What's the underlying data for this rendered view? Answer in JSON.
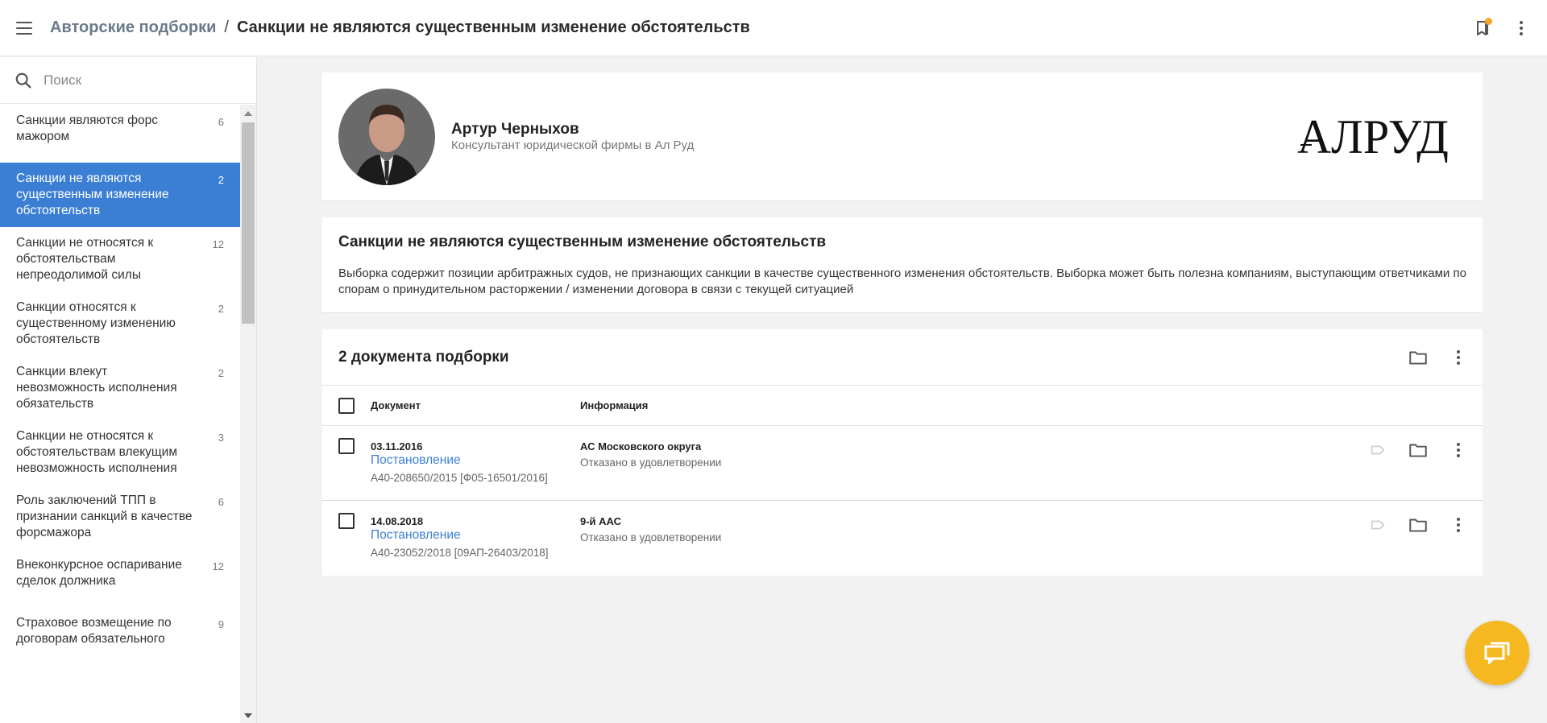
{
  "header": {
    "breadcrumb_parent": "Авторские подборки",
    "breadcrumb_separator": "/",
    "breadcrumb_current": "Санкции не являются существенным изменение обстоятельств"
  },
  "search": {
    "placeholder": "Поиск"
  },
  "sidebar": {
    "items": [
      {
        "label": "Санкции являются форс мажором",
        "count": "6"
      },
      {
        "label": "Санкции не являются существенным изменение обстоятельств",
        "count": "2"
      },
      {
        "label": "Санкции не относятся к обстоятельствам непреодолимой силы",
        "count": "12"
      },
      {
        "label": "Санкции относятся к существенному изменению обстоятельств",
        "count": "2"
      },
      {
        "label": "Санкции влекут невозможность исполнения обязательств",
        "count": "2"
      },
      {
        "label": "Санкции не относятся к обстоятельствам влекущим невозможность исполнения",
        "count": "3"
      },
      {
        "label": "Роль заключений ТПП в признании санкций в качестве форсмажора",
        "count": "6"
      },
      {
        "label": "Внеконкурсное оспаривание сделок должника",
        "count": "12"
      },
      {
        "label": "Страховое возмещение по договорам обязательного",
        "count": "9"
      }
    ]
  },
  "author": {
    "name": "Артур Черныхов",
    "role": "Консультант юридической фирмы в Ал Руд",
    "logo_text": "АЛРУД"
  },
  "collection": {
    "title": "Санкции не являются существенным изменение обстоятельств",
    "description": "Выборка содержит позиции арбитражных судов, не признающих санкции в качестве существенного изменения обстоятельств. Выборка может быть полезна компаниям, выступающим ответчиками по спорам о принудительном расторжении / изменении договора в связи с текущей ситуацией"
  },
  "documents": {
    "heading": "2 документа подборки",
    "columns": {
      "document": "Документ",
      "info": "Информация"
    },
    "rows": [
      {
        "date": "03.11.2016",
        "type": "Постановление",
        "number": "А40-208650/2015 [Ф05-16501/2016]",
        "court": "АС Московского округа",
        "result": "Отказано в удовлетворении"
      },
      {
        "date": "14.08.2018",
        "type": "Постановление",
        "number": "А40-23052/2018 [09АП-26403/2018]",
        "court": "9-й ААС",
        "result": "Отказано в удовлетворении"
      }
    ]
  },
  "colors": {
    "accent": "#3b7fd4",
    "badge": "#f5a623",
    "fab": "#f5b820"
  },
  "icons": [
    "menu-icon",
    "bookmarks-icon",
    "more-vert-icon",
    "search-icon",
    "folder-icon",
    "label-icon",
    "chat-icon"
  ]
}
